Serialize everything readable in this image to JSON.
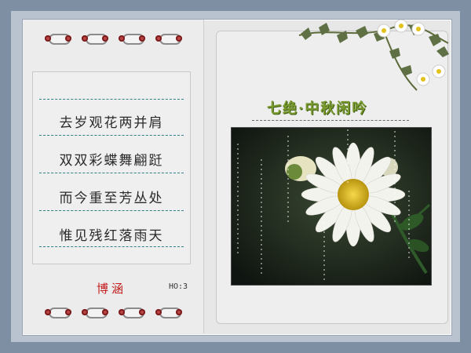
{
  "poem": {
    "title": "七绝·中秋闲吟",
    "lines": [
      "去岁观花两并肩",
      "双双彩蝶舞翩跹",
      "而今重至芳丛处",
      "惟见残红落雨天"
    ],
    "author": "博涵",
    "code": "HO:3"
  },
  "icons": {
    "rings": "binder-ring-icon",
    "vine": "ivy-daisy-decoration-icon",
    "photo": "white-daisy-photo"
  },
  "colors": {
    "frame": "#7e8ea3",
    "title": "#7a9a30",
    "author": "#c21c1c",
    "rule": "#2f7f86"
  }
}
